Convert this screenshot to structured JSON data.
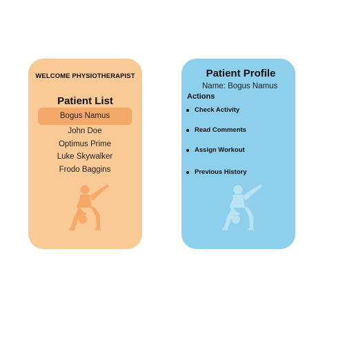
{
  "left_panel": {
    "welcome": "WELCOME PHYSIOTHERAPIST",
    "list_title": "Patient List",
    "patients": [
      "Bogus Namus",
      "John Doe",
      "Optimus Prime",
      "Luke Skywalker",
      "Frodo Baggins"
    ],
    "selected_index": 0,
    "colors": {
      "background": "#f9c996",
      "selected": "#f4a86a",
      "figure": "#f5a868"
    }
  },
  "right_panel": {
    "title": "Patient Profile",
    "name_line": "Name: Bogus Namus",
    "actions_label": "Actions",
    "actions": [
      "Check Activity",
      "Read Comments",
      "Assign Workout",
      "Previous History"
    ],
    "colors": {
      "background": "#8ed0ec",
      "figure": "#b9e3f3"
    }
  },
  "icons": {
    "figure": "kettlebell-athlete-silhouette"
  }
}
